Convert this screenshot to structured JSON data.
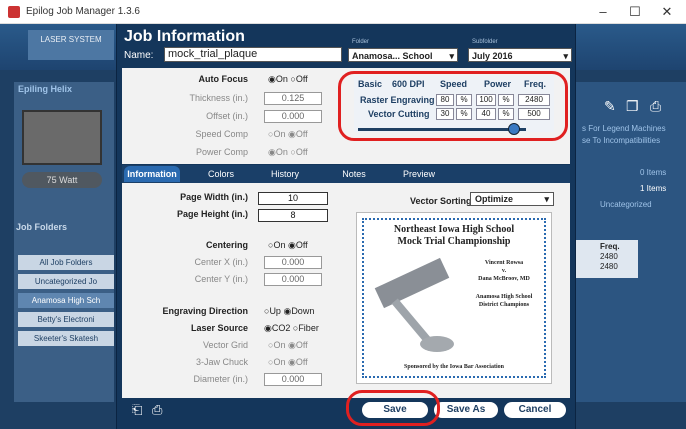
{
  "window": {
    "title": "Epilog Job Manager 1.3.6"
  },
  "bg": {
    "laser_system": "LASER SYSTEM",
    "device": "Epiling Helix",
    "watt": "75 Watt",
    "job_folders": "Job Folders",
    "folders": [
      "All Job Folders",
      "Uncategorized Jo",
      "Anamosa High Sch",
      "Betty's Electroni",
      "Skeeter's Skatesh"
    ],
    "right": {
      "line1": "s For Legend Machines",
      "line2": "se To Incompatibilities",
      "items_hdr": "0 Items",
      "items": "1 Items",
      "uncat": "Uncategorized",
      "freq_hdr": "Freq.",
      "freq_vals": [
        "2480",
        "2480"
      ]
    }
  },
  "dialog": {
    "title": "Job Information",
    "name_label": "Name:",
    "name_value": "mock_trial_plaque",
    "folder_label": "Folder",
    "folder_value": "Anamosa... School",
    "subfolder_label": "Subfolder",
    "subfolder_value": "July 2016",
    "settings": {
      "autofocus": "Auto Focus",
      "thickness": "Thickness (in.)",
      "thickness_val": "0.125",
      "offset": "Offset (in.)",
      "offset_val": "0.000",
      "speedcomp": "Speed Comp",
      "powercomp": "Power Comp",
      "on": "On",
      "off": "Off"
    },
    "speed": {
      "basic": "Basic",
      "dpi": "600 DPI",
      "hdr_speed": "Speed",
      "hdr_power": "Power",
      "hdr_freq": "Freq.",
      "pct": "%",
      "rows": [
        {
          "label": "Raster Engraving",
          "speed": "80",
          "power": "100",
          "freq": "2480"
        },
        {
          "label": "Vector Cutting",
          "speed": "30",
          "power": "40",
          "freq": "500"
        }
      ]
    },
    "tabs": [
      "Information",
      "Colors",
      "History",
      "Notes",
      "Preview"
    ],
    "info": {
      "page_width": "Page Width (in.)",
      "page_width_val": "10",
      "page_height": "Page Height (in.)",
      "page_height_val": "8",
      "centering": "Centering",
      "center_x": "Center X (in.)",
      "center_x_val": "0.000",
      "center_y": "Center Y (in.)",
      "center_y_val": "0.000",
      "eng_dir": "Engraving Direction",
      "up": "Up",
      "down": "Down",
      "laser_source": "Laser Source",
      "co2": "CO2",
      "fiber": "Fiber",
      "vector_grid": "Vector Grid",
      "chuck": "3-Jaw Chuck",
      "diameter": "Diameter (in.)",
      "diameter_val": "0.000",
      "vector_sorting": "Vector Sorting",
      "vector_sorting_val": "Optimize"
    },
    "preview": {
      "l1": "Northeast Iowa High School",
      "l2": "Mock Trial Championship",
      "p1": "Vincent Rowsa",
      "p2": "v.",
      "p3": "Dana McBroov, MD",
      "s1": "Anamosa High School",
      "s2": "District Champions",
      "footer": "Sponsored by the Iowa Bar Association"
    },
    "buttons": {
      "save": "Save",
      "saveas": "Save As",
      "cancel": "Cancel"
    }
  },
  "colors": {
    "highlight": "#e02020",
    "dialog": "#14365b",
    "accent": "#2a6ab0"
  }
}
